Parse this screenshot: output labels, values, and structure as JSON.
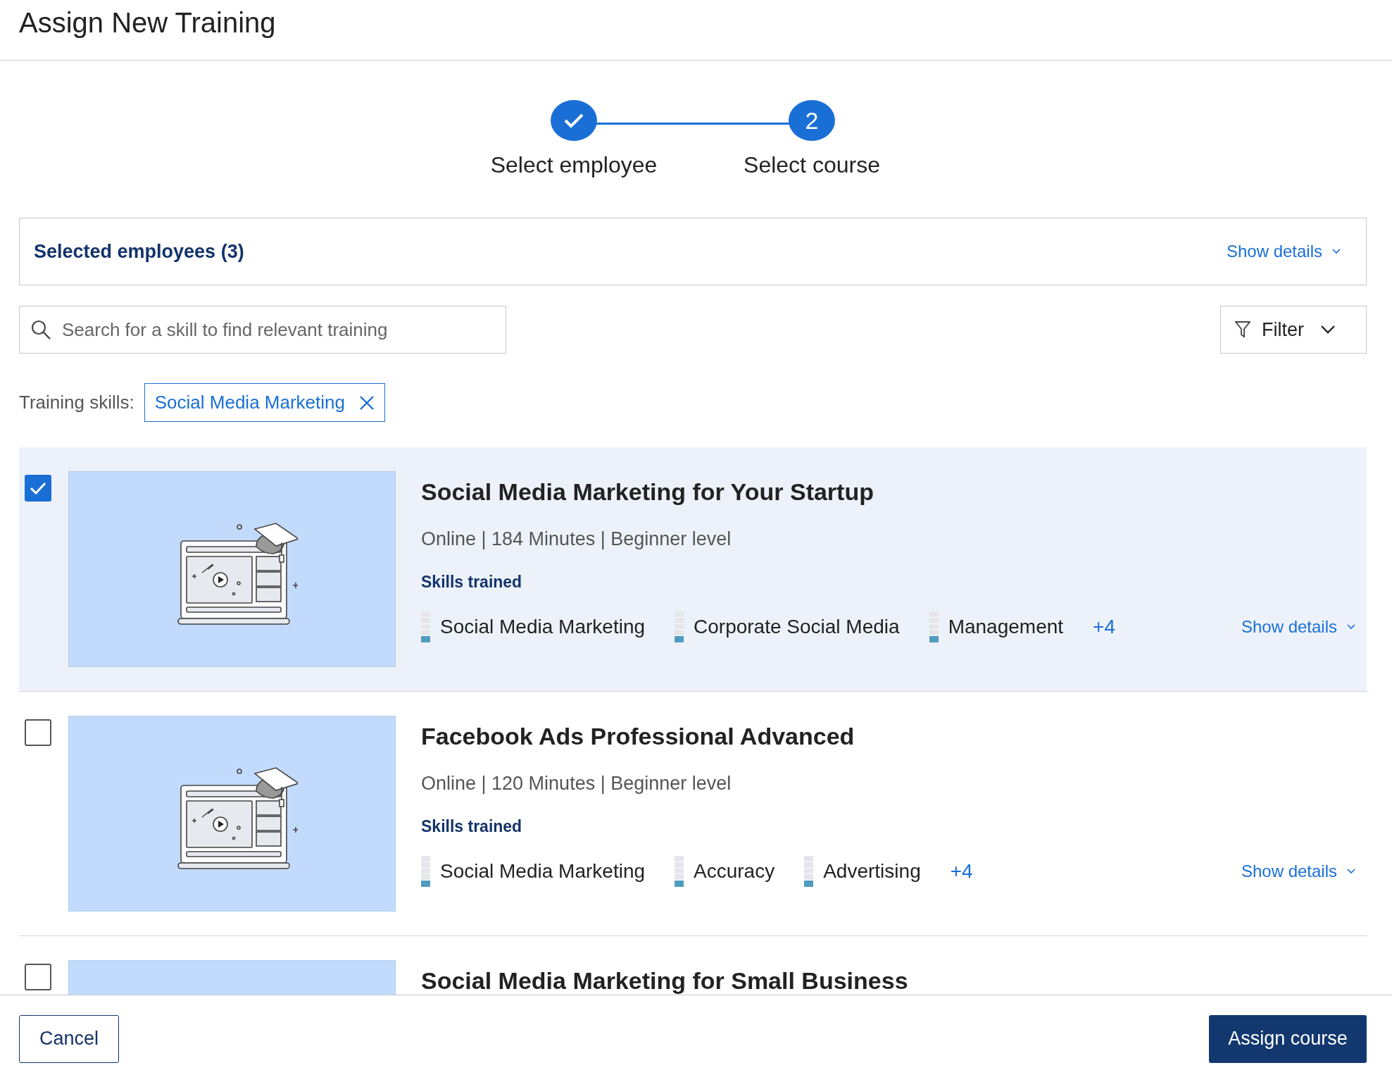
{
  "window": {
    "title": "Assign New Training"
  },
  "steps": [
    {
      "label": "Select employee",
      "completed": true
    },
    {
      "label": "Select course",
      "completed": false,
      "number": "2"
    }
  ],
  "selected_employees": {
    "label": "Selected employees (3)",
    "toggle": "Show details"
  },
  "search": {
    "placeholder": "Search for a skill to find relevant training"
  },
  "filter": {
    "label": "Filter"
  },
  "training_skills": {
    "label": "Training skills:",
    "chips": [
      "Social Media Marketing"
    ]
  },
  "courses": [
    {
      "title": "Social Media Marketing for Your Startup",
      "meta": "Online | 184 Minutes | Beginner level",
      "skills_heading": "Skills trained",
      "skills": [
        {
          "name": "Social Media Marketing",
          "level": 0.2
        },
        {
          "name": "Corporate Social Media",
          "level": 0.2
        },
        {
          "name": "Management",
          "level": 0.2
        }
      ],
      "more": "+4",
      "toggle": "Show details",
      "selected": true
    },
    {
      "title": "Facebook Ads Professional Advanced",
      "meta": "Online | 120 Minutes | Beginner level",
      "skills_heading": "Skills trained",
      "skills": [
        {
          "name": "Social Media Marketing",
          "level": 0.2
        },
        {
          "name": "Accuracy",
          "level": 0.2
        },
        {
          "name": "Advertising",
          "level": 0.2
        }
      ],
      "more": "+4",
      "toggle": "Show details",
      "selected": false
    },
    {
      "title": "Social Media Marketing for Small Business",
      "selected": false
    }
  ],
  "footer": {
    "cancel": "Cancel",
    "assign": "Assign course"
  }
}
